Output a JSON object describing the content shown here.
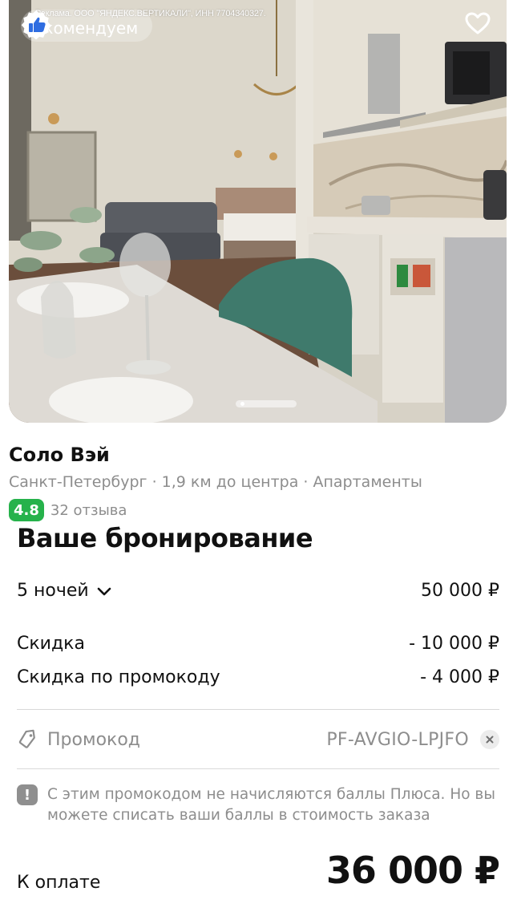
{
  "ad": {
    "disclaimer": "Реклама. ООО \"ЯНДЕКС.ВЕРТИКАЛИ\", ИНН 7704340327.",
    "recommended_label": "Рекомендуем",
    "badge_icon": "thumbs-up-icon",
    "favorite_icon": "heart-icon"
  },
  "gallery": {
    "slides_indicator": "dots"
  },
  "hotel": {
    "name": "Соло Вэй",
    "meta": "Санкт-Петербург · 1,9 км до центра · Апартаменты",
    "rating": "4.8",
    "reviews": "32 отзыва"
  },
  "booking": {
    "title": "Ваше бронирование",
    "nights_label": "5 ночей",
    "nights_price": "50 000 ₽",
    "discount_label": "Скидка",
    "discount_value": "- 10 000 ₽",
    "promo_discount_label": "Скидка по промокоду",
    "promo_discount_value": "- 4 000 ₽",
    "promo_label": "Промокод",
    "promo_code": "PF-AVGIO-LPJFO",
    "notice": "С этим промокодом не начисляются баллы Плюса. Но вы можете списать ваши баллы в стоимость заказа",
    "total_label": "К оплате",
    "total_value": "36 000 ₽"
  },
  "colors": {
    "rating_badge": "#26b24b",
    "secondary_text": "#8d8d8d",
    "primary_text": "#111111",
    "ad_badge": "#2f6de1"
  }
}
